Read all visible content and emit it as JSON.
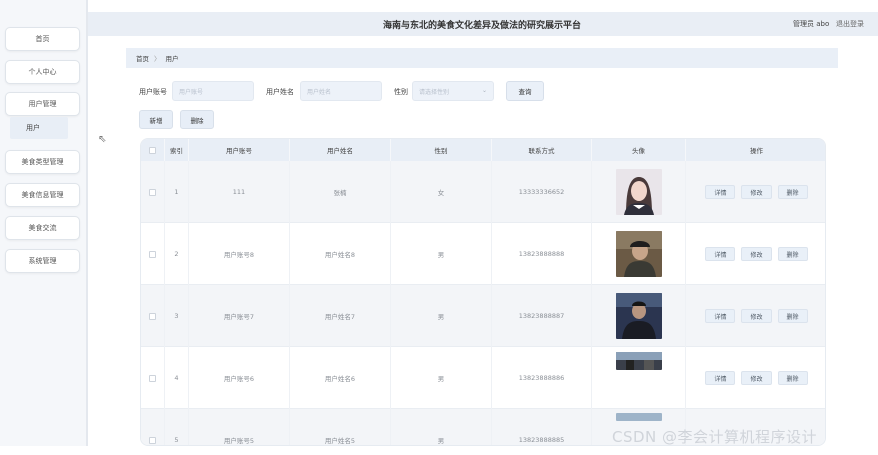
{
  "header": {
    "title": "海南与东北的美食文化差异及做法的研究展示平台",
    "user": "管理员 abo",
    "logout": "退出登录"
  },
  "sidebar": {
    "items": [
      {
        "label": "首页"
      },
      {
        "label": "个人中心"
      },
      {
        "label": "用户管理"
      },
      {
        "label": "用户"
      },
      {
        "label": "美食类型管理"
      },
      {
        "label": "美食信息管理"
      },
      {
        "label": "美食交流"
      },
      {
        "label": "系统管理"
      }
    ]
  },
  "breadcrumb": {
    "home": "首页",
    "separator": "〉",
    "current": "用户"
  },
  "search": {
    "account_label": "用户账号",
    "account_placeholder": "用户账号",
    "name_label": "用户姓名",
    "name_placeholder": "用户姓名",
    "gender_label": "性别",
    "gender_placeholder": "请选择性别",
    "query_label": "查询"
  },
  "actions": {
    "add_label": "新增",
    "delete_label": "删除"
  },
  "table": {
    "columns": [
      "",
      "索引",
      "用户账号",
      "用户姓名",
      "性别",
      "联系方式",
      "头像",
      "操作"
    ],
    "rows": [
      {
        "index": "1",
        "account": "111",
        "name": "张楠",
        "gender": "女",
        "phone": "13333336652",
        "avatar": "avatar-girl"
      },
      {
        "index": "2",
        "account": "用户账号8",
        "name": "用户姓名8",
        "gender": "男",
        "phone": "13823888888",
        "avatar": "avatar-man-cap"
      },
      {
        "index": "3",
        "account": "用户账号7",
        "name": "用户姓名7",
        "gender": "男",
        "phone": "13823888887",
        "avatar": "avatar-man-dark"
      },
      {
        "index": "4",
        "account": "用户账号6",
        "name": "用户姓名6",
        "gender": "男",
        "phone": "13823888886",
        "avatar": "avatar-partial"
      },
      {
        "index": "5",
        "account": "用户账号5",
        "name": "用户姓名5",
        "gender": "男",
        "phone": "13823888885",
        "avatar": "avatar-partial-2"
      }
    ],
    "row_buttons": {
      "detail": "详情",
      "edit": "修改",
      "delete": "删除"
    }
  },
  "watermark": "CSDN @李会计算机程序设计",
  "colors": {
    "header_bg": "#e9eef5",
    "sidebar_bg": "#f5f7fa",
    "table_header_bg": "#e8eef6",
    "button_bg": "#e7eef7"
  }
}
